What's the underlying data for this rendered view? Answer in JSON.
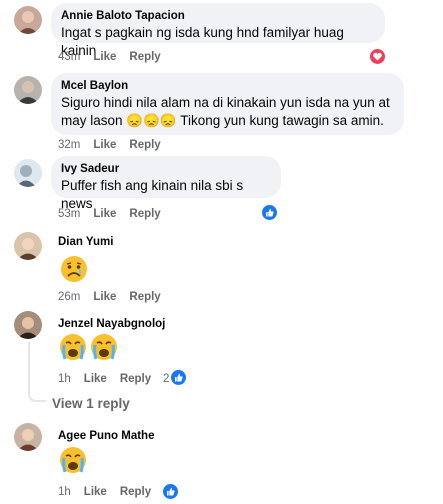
{
  "comments": [
    {
      "name": "Annie Baloto Tapacion",
      "text": "Ingat s pagkain ng isda kung hnd familyar huag kainin",
      "time": "43m",
      "like": "Like",
      "reply": "Reply",
      "reaction": "love"
    },
    {
      "name": "Mcel Baylon",
      "text_line1": "Siguro hindi nila alam na di kinakain yun isda na yun at",
      "text_line2_a": "may lason",
      "text_line2_emojis": "😞😞😞",
      "text_line2_b": "Tikong yun kung tawagin sa amin.",
      "time": "32m",
      "like": "Like",
      "reply": "Reply"
    },
    {
      "name": "Ivy Sadeur",
      "text": "Puffer fish ang kinain nila sbi s news",
      "time": "53m",
      "like": "Like",
      "reply": "Reply",
      "reaction": "like"
    },
    {
      "name": "Dian Yumi",
      "emoji": "sad-face",
      "time": "26m",
      "like": "Like",
      "reply": "Reply"
    },
    {
      "name": "Jenzel Nayabgnoloj",
      "emoji": "crying-face",
      "time": "1h",
      "like": "Like",
      "reply": "Reply",
      "reaction_count": "2",
      "reaction": "like"
    },
    {
      "name": "Agee Puno Mathe",
      "emoji": "crying-face",
      "time": "1h",
      "like": "Like",
      "reply": "Reply",
      "reaction": "like"
    }
  ],
  "view_replies": "View 1 reply",
  "colors": {
    "bubble": "#f0f2f5",
    "meta": "#65676b",
    "like_blue": "#1877f2",
    "love_red": "#f33e58"
  }
}
